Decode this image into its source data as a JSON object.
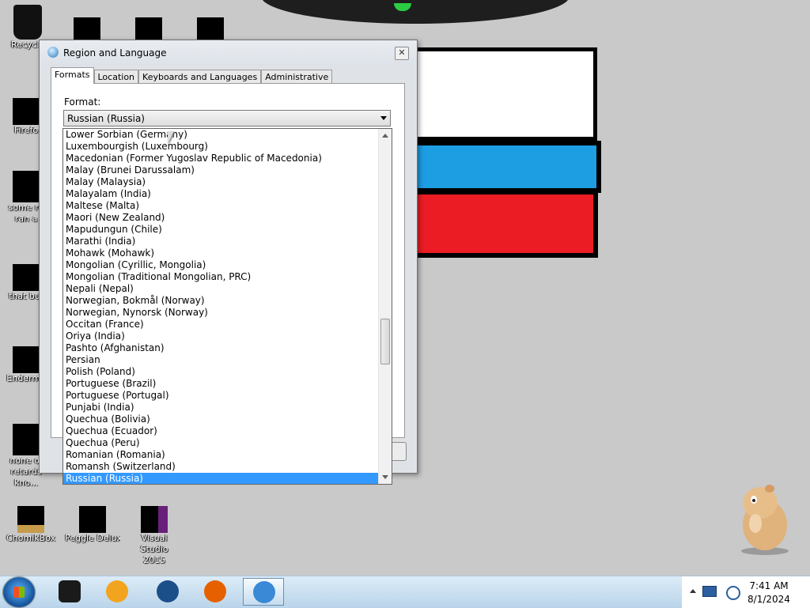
{
  "desktop": {
    "icons": [
      {
        "label": "Recycle",
        "name": "recycle-bin"
      },
      {
        "label": "Firefo",
        "name": "firefox"
      },
      {
        "label": "some ru\nran a",
        "name": "folder-some"
      },
      {
        "label": "that but",
        "name": "folder-that-but"
      },
      {
        "label": "Enderma",
        "name": "enderman"
      },
      {
        "label": "none of\nretards kno...",
        "name": "none-of"
      },
      {
        "label": "ChomikBox",
        "name": "chomikbox"
      },
      {
        "label": "Peggle Deluxe",
        "name": "peggle-deluxe"
      },
      {
        "label": "Visual Studio\n2015",
        "name": "visual-studio-2015"
      }
    ]
  },
  "dialog": {
    "title": "Region and Language",
    "close_glyph": "✕",
    "tabs": [
      "Formats",
      "Location",
      "Keyboards and Languages",
      "Administrative"
    ],
    "active_tab": "Formats",
    "format_label": "Format:",
    "format_value": "Russian (Russia)"
  },
  "dropdown": {
    "items": [
      "Lower Sorbian (Germany)",
      "Luxembourgish (Luxembourg)",
      "Macedonian (Former Yugoslav Republic of Macedonia)",
      "Malay (Brunei Darussalam)",
      "Malay (Malaysia)",
      "Malayalam (India)",
      "Maltese (Malta)",
      "Maori (New Zealand)",
      "Mapudungun (Chile)",
      "Marathi (India)",
      "Mohawk (Mohawk)",
      "Mongolian (Cyrillic, Mongolia)",
      "Mongolian (Traditional Mongolian, PRC)",
      "Nepali (Nepal)",
      "Norwegian, Bokmål (Norway)",
      "Norwegian, Nynorsk (Norway)",
      "Occitan (France)",
      "Oriya (India)",
      "Pashto (Afghanistan)",
      "Persian",
      "Polish (Poland)",
      "Portuguese (Brazil)",
      "Portuguese (Portugal)",
      "Punjabi (India)",
      "Quechua (Bolivia)",
      "Quechua (Ecuador)",
      "Quechua (Peru)",
      "Romanian (Romania)",
      "Romansh (Switzerland)",
      "Russian (Russia)"
    ],
    "selected": "Russian (Russia)"
  },
  "taskbar": {
    "buttons": [
      {
        "name": "explorer-taskbar-button",
        "color": "#1a1a1a"
      },
      {
        "name": "media-player-taskbar-button",
        "color": "#f3a41f"
      },
      {
        "name": "browser-taskbar-button",
        "color": "#1b4f8a"
      },
      {
        "name": "firefox-taskbar-button",
        "color": "#e66000"
      },
      {
        "name": "region-language-taskbar-button",
        "color": "#3a89d6",
        "active": true
      }
    ],
    "clock_time": "7:41 AM",
    "clock_date": "8/1/2024"
  }
}
